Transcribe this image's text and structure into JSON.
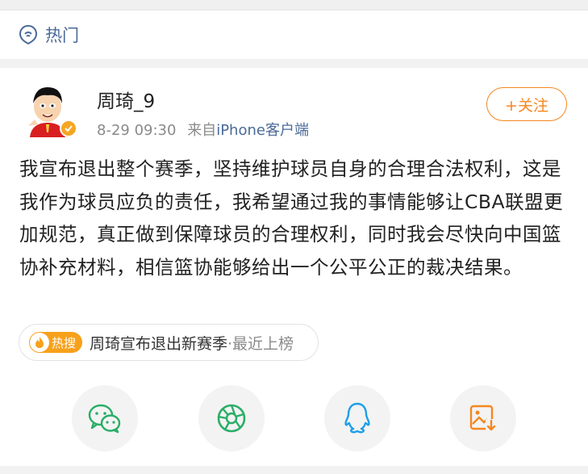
{
  "header": {
    "hot_label": "热门"
  },
  "post": {
    "username": "周琦_9",
    "timestamp": "8-29 09:30",
    "source_prefix": "来自",
    "source_name": "iPhone客户端",
    "follow_label": "+关注",
    "content": "我宣布退出整个赛季，坚持维护球员自身的合理合法权利，这是我作为球员应负的责任，我希望通过我的事情能够让CBA联盟更加规范，真正做到保障球员的合理权利，同时我会尽快向中国篮协补充材料，相信篮协能够给出一个公平公正的裁决结果。"
  },
  "topic": {
    "badge_label": "热搜",
    "title": "周琦宣布退出新赛季",
    "suffix": "·最近上榜"
  },
  "share": {
    "icons": [
      "wechat-icon",
      "moments-icon",
      "qq-icon",
      "save-image-icon"
    ]
  },
  "colors": {
    "link_blue": "#4a6a98",
    "accent_orange": "#f5871f",
    "badge_orange": "#f7a11b",
    "wechat_green": "#2aae67",
    "qq_blue": "#1e9fe8"
  }
}
